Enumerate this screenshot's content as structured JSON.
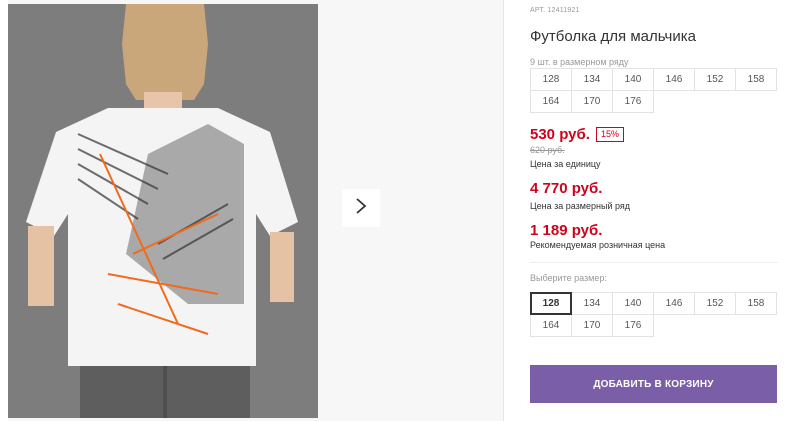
{
  "product": {
    "article": "АРТ. 12411921",
    "title": "Футболка для мальчика",
    "size_note": "9 шт. в размерном ряду",
    "sizes_row": [
      "128",
      "134",
      "140",
      "146",
      "152",
      "158",
      "164",
      "170",
      "176"
    ]
  },
  "pricing": {
    "price": "530 руб.",
    "discount": "15%",
    "old_price": "620 руб.",
    "unit_label": "Цена за единицу",
    "row_price": "4 770 руб.",
    "row_label": "Цена за размерный ряд",
    "rrp_price": "1 189 руб.",
    "rrp_label": "Рекомендуемая розничная цена"
  },
  "size_select": {
    "label": "Выберите размер:",
    "options": [
      "128",
      "134",
      "140",
      "146",
      "152",
      "158",
      "164",
      "170",
      "176"
    ],
    "selected": "128"
  },
  "cart": {
    "add_label": "ДОБАВИТЬ В КОРЗИНУ"
  },
  "gallery": {
    "next_icon": "chevron-right-icon"
  },
  "colors": {
    "accent": "#7a5ea8",
    "price": "#d0021b",
    "print_orange": "#f26a1b"
  }
}
